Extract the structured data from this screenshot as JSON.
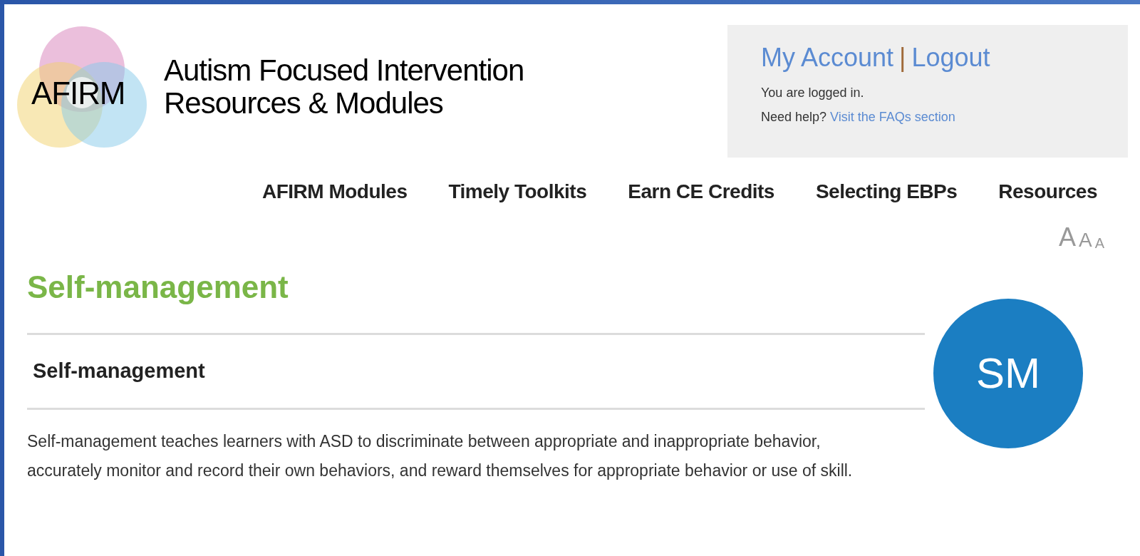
{
  "logo": {
    "mark": "AFIRM",
    "title_lines": [
      "Autism Focused Intervention",
      "Resources & Modules"
    ]
  },
  "account": {
    "links": [
      "My Account",
      "Logout"
    ],
    "separator": "|",
    "status": "You are logged in.",
    "help_text": "Need help?",
    "help_link": "Visit the FAQs section"
  },
  "nav": [
    "AFIRM Modules",
    "Timely Toolkits",
    "Earn CE Credits",
    "Selecting EBPs",
    "Resources"
  ],
  "font_size_buttons": [
    {
      "label": "A",
      "kind": "large"
    },
    {
      "label": "A",
      "kind": "medium"
    },
    {
      "label": "A",
      "kind": "small"
    }
  ],
  "page_title": "Self-management",
  "section_title": "Self-management",
  "badge": "SM",
  "description": "Self-management teaches learners with ASD to discriminate between appropriate and inappropriate behavior, accurately monitor and record their own behaviors, and reward themselves for appropriate behavior or use of skill."
}
